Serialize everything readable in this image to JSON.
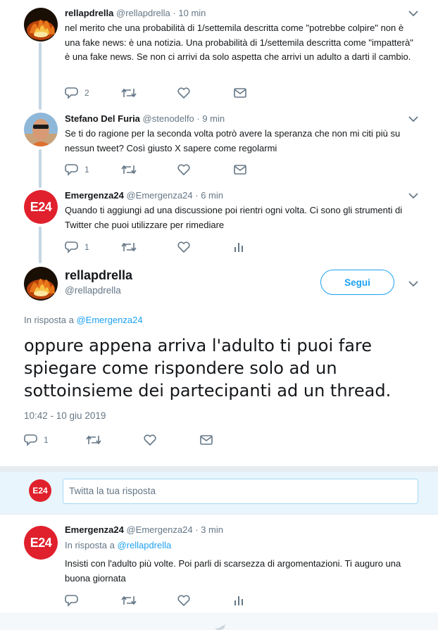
{
  "tweets": [
    {
      "name": "rellapdrella",
      "handle": "@rellapdrella",
      "dot": "·",
      "time": "10 min",
      "text": "nel merito che una probabilità di 1/settemila descritta come \"potrebbe colpire\" non è una fake news: è una notizia. Una probabilità di 1/settemila descritta come \"impatterà\" è una fake news. Se non ci arrivi da solo aspetta che arrivi un adulto a darti il cambio.",
      "reply_count": "2",
      "icons": [
        "reply-icon",
        "retweet-icon",
        "like-icon",
        "message-icon"
      ]
    },
    {
      "name": "Stefano Del Furia",
      "handle": "@stenodelfo",
      "dot": "·",
      "time": "9 min",
      "text": "Se ti do ragione per la seconda volta potrò avere la speranza che non mi citi più su nessun tweet? Così giusto X sapere come regolarmi",
      "reply_count": "1",
      "icons": [
        "reply-icon",
        "retweet-icon",
        "like-icon",
        "message-icon"
      ]
    },
    {
      "name": "Emergenza24",
      "handle": "@Emergenza24",
      "dot": "·",
      "time": "6 min",
      "avatar_text": "E24",
      "text": "Quando ti aggiungi ad una discussione poi rientri ogni volta. Ci sono gli strumenti di Twitter che puoi utilizzare per rimediare",
      "reply_count": "1",
      "icons": [
        "reply-icon",
        "retweet-icon",
        "like-icon",
        "analytics-icon"
      ]
    }
  ],
  "main_tweet": {
    "name": "rellapdrella",
    "handle": "@rellapdrella",
    "follow_label": "Segui",
    "reply_to_prefix": "In risposta a",
    "reply_to_user": "@Emergenza24",
    "text": "oppure appena arriva l'adulto ti puoi fare spiegare come rispondere solo ad un sottoinsieme dei partecipanti ad un thread.",
    "timestamp": "10:42 - 10 giu 2019",
    "reply_count": "1"
  },
  "reply_box": {
    "avatar_text": "E24",
    "placeholder": "Twitta la tua risposta"
  },
  "reply_tweet": {
    "name": "Emergenza24",
    "handle": "@Emergenza24",
    "dot": "·",
    "time": "3 min",
    "avatar_text": "E24",
    "reply_to_prefix": "In risposta a",
    "reply_to_user": "@rellapdrella",
    "text": "Insisti con l'adulto più volte. Poi parli di scarsezza di argomentazioni. Ti auguro una buona giornata"
  },
  "colors": {
    "accent": "#1da1f2",
    "muted": "#657786",
    "text": "#14171a",
    "thread_line": "#c5d6e3",
    "e24_red": "#e0202c"
  }
}
